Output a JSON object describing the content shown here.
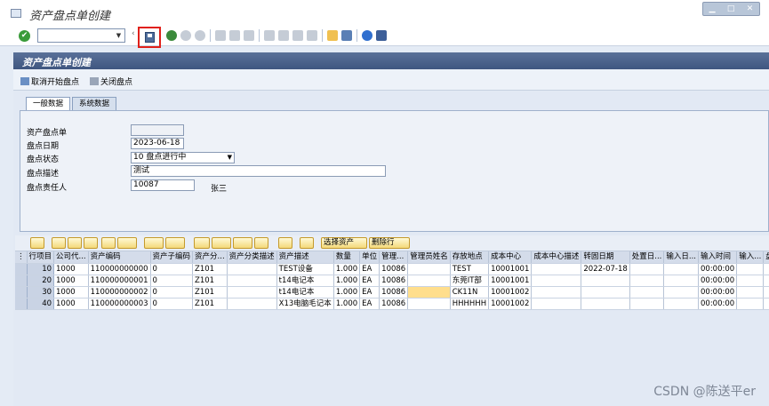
{
  "window": {
    "title": "资产盘点单创建"
  },
  "toolbar": {
    "command_value": ""
  },
  "page": {
    "header": "资产盘点单创建"
  },
  "actions": {
    "cancel_label": "取消开始盘点",
    "close_label": "关闭盘点"
  },
  "tabs": [
    {
      "label": "一般数据",
      "active": true
    },
    {
      "label": "系统数据",
      "active": false
    }
  ],
  "form": {
    "doc_label": "资产盘点单",
    "doc_value": "",
    "date_label": "盘点日期",
    "date_value": "2023-06-18",
    "status_label": "盘点状态",
    "status_value": "10 盘点进行中",
    "desc_label": "盘点描述",
    "desc_value": "测试",
    "owner_label": "盘点责任人",
    "owner_value": "10087",
    "owner_name": "张三"
  },
  "grid_toolbar": {
    "select_assets": "选择资产",
    "delete_row": "删除行"
  },
  "table": {
    "headers": [
      "行项目",
      "公司代...",
      "资产编码",
      "资产子编码",
      "资产分...",
      "资产分类描述",
      "资产描述",
      "数量",
      "单位",
      "管理...",
      "管理员姓名",
      "存放地点",
      "成本中心",
      "成本中心描述",
      "转固日期",
      "处置日...",
      "输入日...",
      "输入时间",
      "输入...",
      "盘点"
    ],
    "rows": [
      [
        "10",
        "1000",
        "110000000000",
        "0",
        "Z101",
        "",
        "TEST设备",
        "1.000",
        "EA",
        "10086",
        "",
        "TEST",
        "10001001",
        "",
        "2022-07-18",
        "",
        "",
        "00:00:00",
        "",
        ""
      ],
      [
        "20",
        "1000",
        "110000000001",
        "0",
        "Z101",
        "",
        "t14电记本",
        "1.000",
        "EA",
        "10086",
        "",
        "东莞IT部",
        "10001001",
        "",
        "",
        "",
        "",
        "00:00:00",
        "",
        ""
      ],
      [
        "30",
        "1000",
        "110000000002",
        "0",
        "Z101",
        "",
        "t14电记本",
        "1.000",
        "EA",
        "10086",
        "",
        "CK11N",
        "10001002",
        "",
        "",
        "",
        "",
        "00:00:00",
        "",
        ""
      ],
      [
        "40",
        "1000",
        "110000000003",
        "0",
        "Z101",
        "",
        "X13电脑毛记本",
        "1.000",
        "EA",
        "10086",
        "",
        "HHHHHH",
        "10001002",
        "",
        "",
        "",
        "",
        "00:00:00",
        "",
        ""
      ]
    ]
  },
  "watermark": "CSDN @陈送平er"
}
